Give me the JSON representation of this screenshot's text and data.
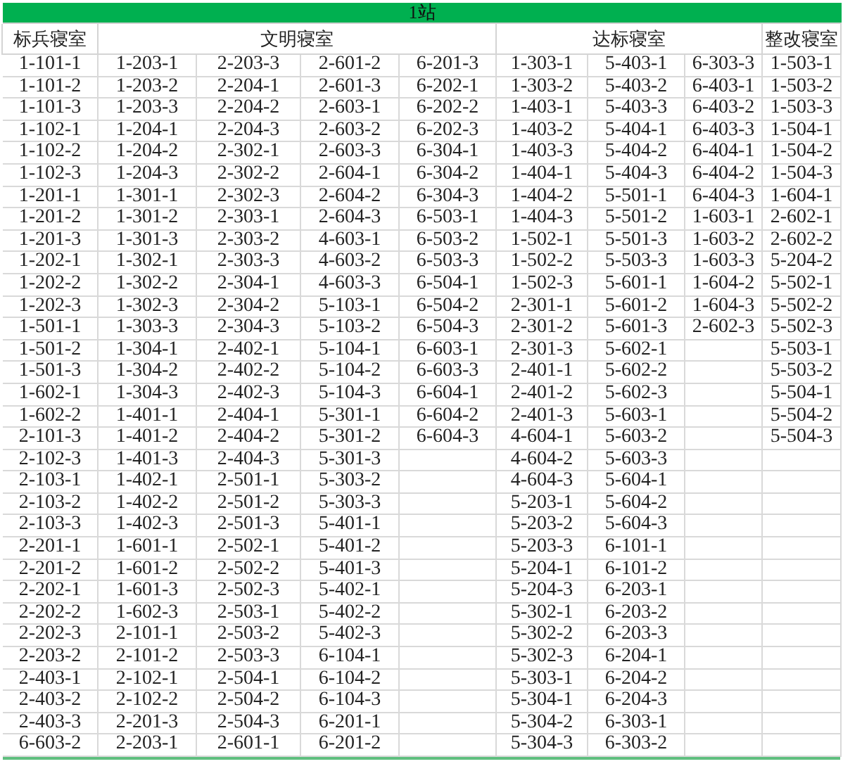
{
  "title": "1站",
  "groups": [
    {
      "label": "标兵寝室",
      "columns": [
        [
          "1-101-1",
          "1-101-2",
          "1-101-3",
          "1-102-1",
          "1-102-2",
          "1-102-3",
          "1-201-1",
          "1-201-2",
          "1-201-3",
          "1-202-1",
          "1-202-2",
          "1-202-3",
          "1-501-1",
          "1-501-2",
          "1-501-3",
          "1-602-1",
          "1-602-2",
          "2-101-3",
          "2-102-3",
          "2-103-1",
          "2-103-2",
          "2-103-3",
          "2-201-1",
          "2-201-2",
          "2-202-1",
          "2-202-2",
          "2-202-3",
          "2-203-2",
          "2-403-1",
          "2-403-2",
          "2-403-3",
          "6-603-2"
        ]
      ]
    },
    {
      "label": "文明寝室",
      "columns": [
        [
          "1-203-1",
          "1-203-2",
          "1-203-3",
          "1-204-1",
          "1-204-2",
          "1-204-3",
          "1-301-1",
          "1-301-2",
          "1-301-3",
          "1-302-1",
          "1-302-2",
          "1-302-3",
          "1-303-3",
          "1-304-1",
          "1-304-2",
          "1-304-3",
          "1-401-1",
          "1-401-2",
          "1-401-3",
          "1-402-1",
          "1-402-2",
          "1-402-3",
          "1-601-1",
          "1-601-2",
          "1-601-3",
          "1-602-3",
          "2-101-1",
          "2-101-2",
          "2-102-1",
          "2-102-2",
          "2-201-3",
          "2-203-1"
        ],
        [
          "2-203-3",
          "2-204-1",
          "2-204-2",
          "2-204-3",
          "2-302-1",
          "2-302-2",
          "2-302-3",
          "2-303-1",
          "2-303-2",
          "2-303-3",
          "2-304-1",
          "2-304-2",
          "2-304-3",
          "2-402-1",
          "2-402-2",
          "2-402-3",
          "2-404-1",
          "2-404-2",
          "2-404-3",
          "2-501-1",
          "2-501-2",
          "2-501-3",
          "2-502-1",
          "2-502-2",
          "2-502-3",
          "2-503-1",
          "2-503-2",
          "2-503-3",
          "2-504-1",
          "2-504-2",
          "2-504-3",
          "2-601-1"
        ],
        [
          "2-601-2",
          "2-601-3",
          "2-603-1",
          "2-603-2",
          "2-603-3",
          "2-604-1",
          "2-604-2",
          "2-604-3",
          "4-603-1",
          "4-603-2",
          "4-603-3",
          "5-103-1",
          "5-103-2",
          "5-104-1",
          "5-104-2",
          "5-104-3",
          "5-301-1",
          "5-301-2",
          "5-301-3",
          "5-303-2",
          "5-303-3",
          "5-401-1",
          "5-401-2",
          "5-401-3",
          "5-402-1",
          "5-402-2",
          "5-402-3",
          "6-104-1",
          "6-104-2",
          "6-104-3",
          "6-201-1",
          "6-201-2"
        ],
        [
          "6-201-3",
          "6-202-1",
          "6-202-2",
          "6-202-3",
          "6-304-1",
          "6-304-2",
          "6-304-3",
          "6-503-1",
          "6-503-2",
          "6-503-3",
          "6-504-1",
          "6-504-2",
          "6-504-3",
          "6-603-1",
          "6-603-3",
          "6-604-1",
          "6-604-2",
          "6-604-3"
        ]
      ]
    },
    {
      "label": "达标寝室",
      "columns": [
        [
          "1-303-1",
          "1-303-2",
          "1-403-1",
          "1-403-2",
          "1-403-3",
          "1-404-1",
          "1-404-2",
          "1-404-3",
          "1-502-1",
          "1-502-2",
          "1-502-3",
          "2-301-1",
          "2-301-2",
          "2-301-3",
          "2-401-1",
          "2-401-2",
          "2-401-3",
          "4-604-1",
          "4-604-2",
          "4-604-3",
          "5-203-1",
          "5-203-2",
          "5-203-3",
          "5-204-1",
          "5-204-3",
          "5-302-1",
          "5-302-2",
          "5-302-3",
          "5-303-1",
          "5-304-1",
          "5-304-2",
          "5-304-3"
        ],
        [
          "5-403-1",
          "5-403-2",
          "5-403-3",
          "5-404-1",
          "5-404-2",
          "5-404-3",
          "5-501-1",
          "5-501-2",
          "5-501-3",
          "5-503-3",
          "5-601-1",
          "5-601-2",
          "5-601-3",
          "5-602-1",
          "5-602-2",
          "5-602-3",
          "5-603-1",
          "5-603-2",
          "5-603-3",
          "5-604-1",
          "5-604-2",
          "5-604-3",
          "6-101-1",
          "6-101-2",
          "6-203-1",
          "6-203-2",
          "6-203-3",
          "6-204-1",
          "6-204-2",
          "6-204-3",
          "6-303-1",
          "6-303-2"
        ],
        [
          "6-303-3",
          "6-403-1",
          "6-403-2",
          "6-403-3",
          "6-404-1",
          "6-404-2",
          "6-404-3",
          "1-603-1",
          "1-603-2",
          "1-603-3",
          "1-604-2",
          "1-604-3",
          "2-602-3"
        ]
      ]
    },
    {
      "label": "整改寝室",
      "columns": [
        [
          "1-503-1",
          "1-503-2",
          "1-503-3",
          "1-504-1",
          "1-504-2",
          "1-504-3",
          "1-604-1",
          "2-602-1",
          "2-602-2",
          "5-204-2",
          "5-502-1",
          "5-502-2",
          "5-502-3",
          "5-503-1",
          "5-503-2",
          "5-504-1",
          "5-504-2",
          "5-504-3"
        ]
      ]
    }
  ]
}
